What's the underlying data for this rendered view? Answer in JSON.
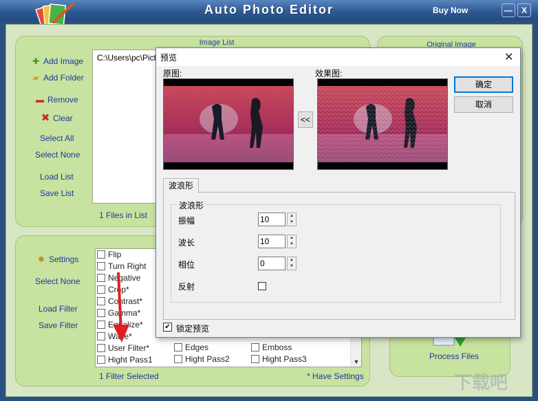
{
  "app": {
    "title": "Auto Photo Editor",
    "buy_now": "Buy Now",
    "minimize": "—",
    "close": "X"
  },
  "image_list": {
    "title": "Image List",
    "add_image": "Add Image",
    "add_folder": "Add Folder",
    "remove": "Remove",
    "clear": "Clear",
    "select_all": "Select All",
    "select_none": "Select None",
    "load_list": "Load List",
    "save_list": "Save List",
    "path": "C:\\Users\\pc\\Pictu",
    "files_count": "1 Files in List"
  },
  "original_image": {
    "title": "Original Image"
  },
  "filters": {
    "settings": "Settings",
    "select_none": "Select None",
    "load_filter": "Load Filter",
    "save_filter": "Save Filter",
    "col1": [
      "Flip",
      "Turn Right",
      "Negative",
      "Crop*",
      "Contrast*",
      "Gamma*",
      "Equalize*",
      "Wave*",
      "User Filter*",
      "Hight Pass1"
    ],
    "col2": [
      "Edges",
      "Hight Pass2"
    ],
    "col3": [
      "Emboss",
      "Hight Pass3"
    ],
    "selected_count": "1 Filter Selected",
    "have_settings": "* Have Settings"
  },
  "process": {
    "label": "Process Files"
  },
  "dialog": {
    "title": "预览",
    "close": "✕",
    "original_label": "原图:",
    "effect_label": "效果图:",
    "copy_button": "<<",
    "ok": "确定",
    "cancel": "取消",
    "tab": "波浪形",
    "group": "波浪形",
    "fields": [
      {
        "label": "振幅",
        "value": "10"
      },
      {
        "label": "波长",
        "value": "10"
      },
      {
        "label": "相位",
        "value": "0"
      }
    ],
    "reflect_label": "反射",
    "lock_preview": "锁定预览",
    "lock_checked": "✔"
  },
  "colors": {
    "accent": "#1e3fa0",
    "panel": "#c8e2a0",
    "title_bar": "#2f5a94"
  }
}
